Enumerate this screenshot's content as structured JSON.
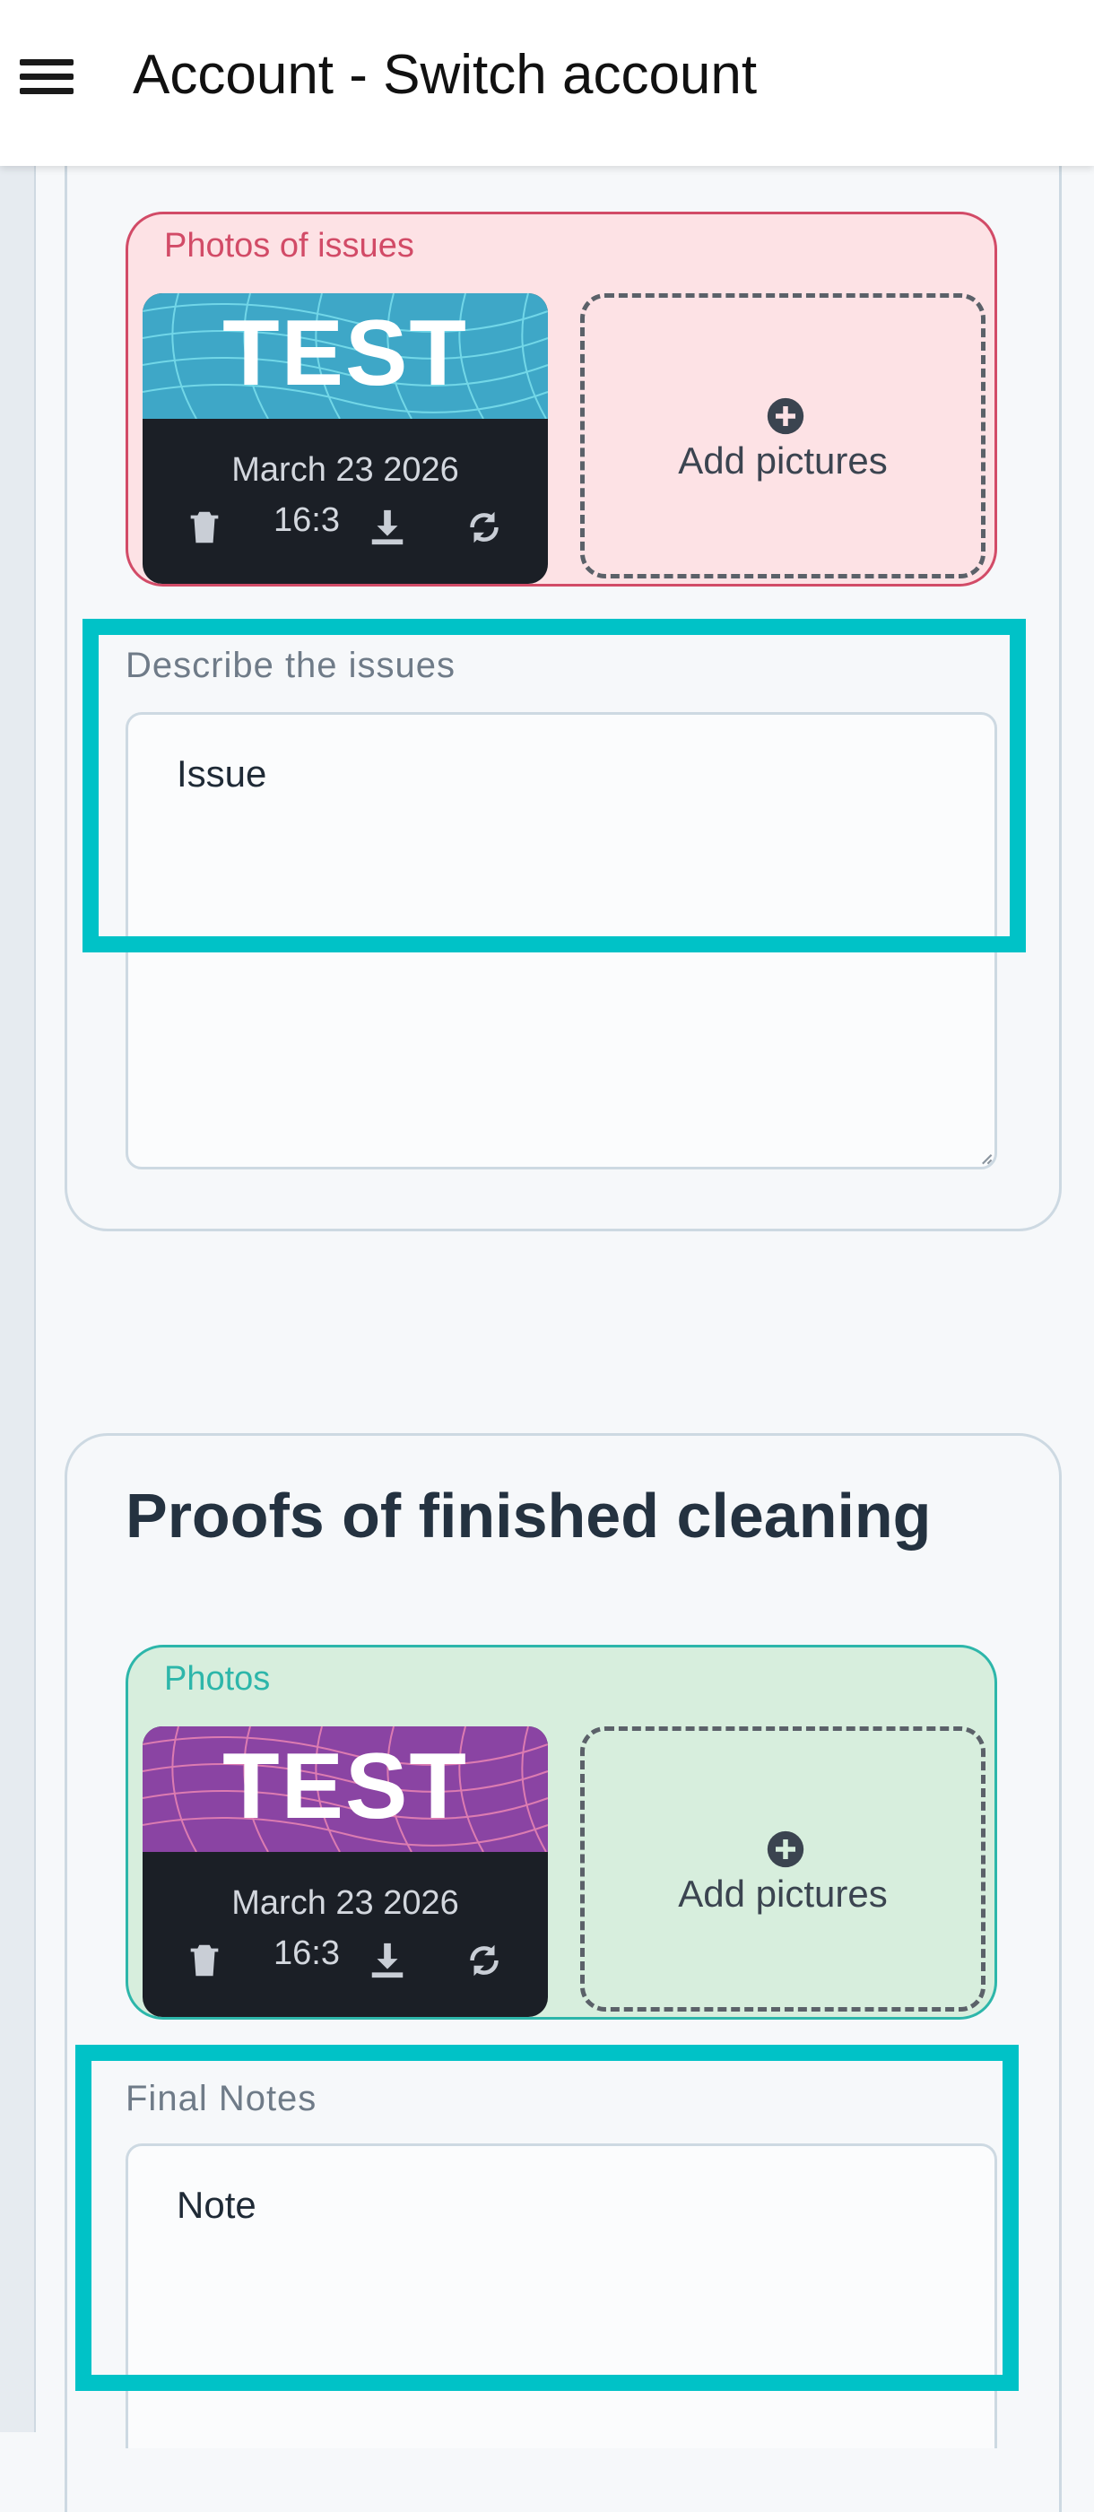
{
  "header": {
    "title": "Account - Switch account",
    "menu_icon": "hamburger-menu-icon"
  },
  "issues": {
    "photos_label": "Photos of issues",
    "photo": {
      "image_text": "TEST IMAGE",
      "date": "March 23 2026",
      "time": "16:3",
      "image_color": "#3ea7c7"
    },
    "add_pictures_label": "Add pictures",
    "describe_label": "Describe the issues",
    "describe_value": "Issue"
  },
  "proofs": {
    "section_title": "Proofs of finished cleaning",
    "photos_label": "Photos",
    "photo": {
      "image_text": "TEST IMAGE",
      "date": "March 23 2026",
      "time": "16:3",
      "image_color": "#8a44a3"
    },
    "add_pictures_label": "Add pictures",
    "notes_label": "Final Notes",
    "notes_value": "Note"
  },
  "colors": {
    "highlight": "#00c2c7",
    "issues_border": "#d24b67",
    "issues_bg": "#fde2e5",
    "proofs_border": "#2db6aa",
    "proofs_bg": "#d7eedd"
  }
}
